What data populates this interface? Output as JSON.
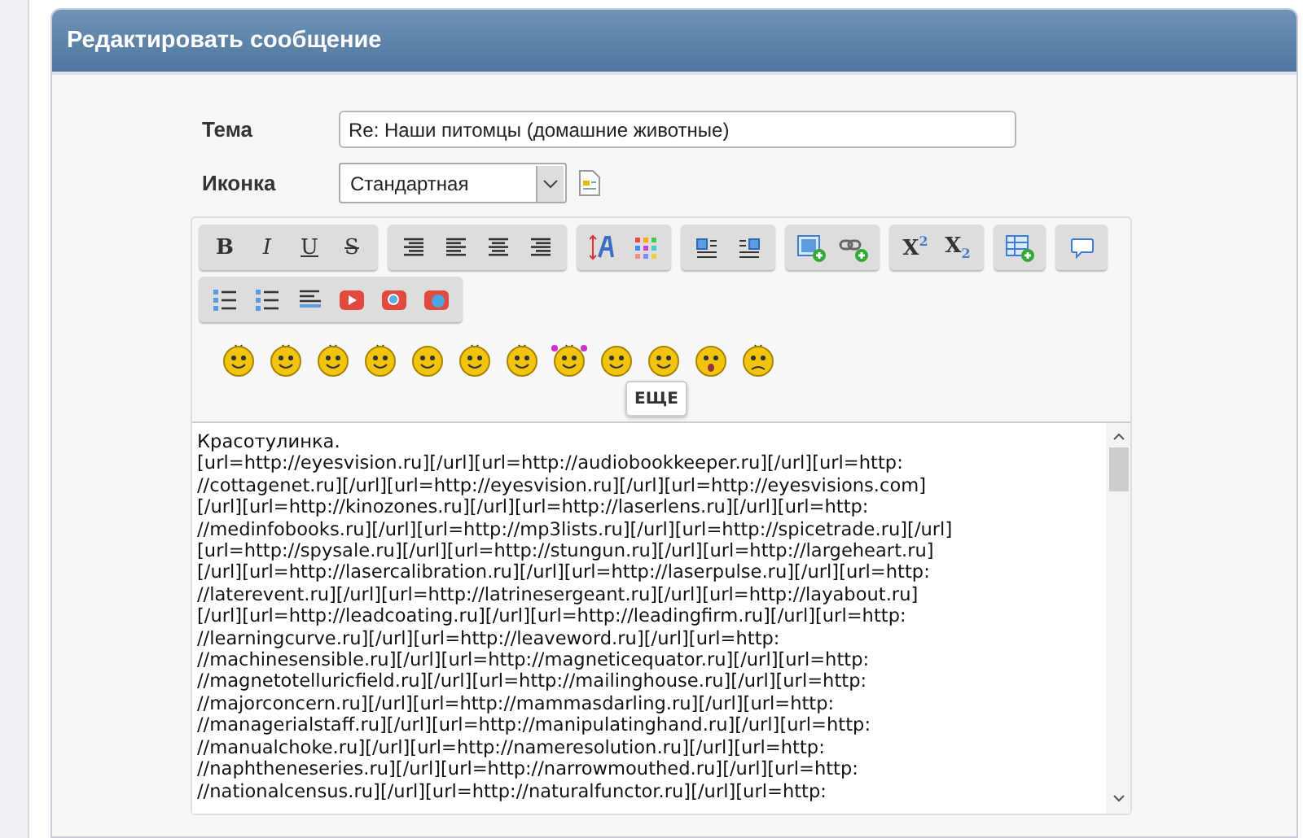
{
  "panel": {
    "title": "Редактировать сообщение"
  },
  "subject": {
    "label": "Тема",
    "value": "Re: Наши питомцы (домашние животные)"
  },
  "icon_field": {
    "label": "Иконка",
    "value": "Стандартная"
  },
  "toolbar": [
    {
      "buttons": [
        {
          "kind": "bold",
          "label": "B"
        },
        {
          "kind": "italic",
          "label": "I"
        },
        {
          "kind": "underline",
          "label": "U"
        },
        {
          "kind": "strike",
          "label": "S"
        }
      ]
    },
    {
      "buttons": [
        {
          "kind": "justify"
        },
        {
          "kind": "align-left"
        },
        {
          "kind": "align-center"
        },
        {
          "kind": "align-right"
        }
      ]
    },
    {
      "buttons": [
        {
          "kind": "font-size"
        },
        {
          "kind": "color"
        }
      ]
    },
    {
      "buttons": [
        {
          "kind": "float-right"
        },
        {
          "kind": "float-left"
        }
      ]
    },
    {
      "buttons": [
        {
          "kind": "image"
        },
        {
          "kind": "link"
        }
      ]
    },
    {
      "buttons": [
        {
          "kind": "sup",
          "label": "X",
          "sub": "2"
        },
        {
          "kind": "sub",
          "label": "X",
          "sub": "2"
        }
      ]
    },
    {
      "buttons": [
        {
          "kind": "table"
        }
      ]
    },
    {
      "buttons": [
        {
          "kind": "quote"
        }
      ]
    },
    {
      "buttons": [
        {
          "kind": "bullets"
        },
        {
          "kind": "numbers"
        },
        {
          "kind": "rule"
        },
        {
          "kind": "video"
        },
        {
          "kind": "media"
        },
        {
          "kind": "embed"
        }
      ]
    }
  ],
  "smileys": [
    {
      "kind": "smile"
    },
    {
      "kind": "wink"
    },
    {
      "kind": "kiss"
    },
    {
      "kind": "angel"
    },
    {
      "kind": "smirk"
    },
    {
      "kind": "wave"
    },
    {
      "kind": "mask"
    },
    {
      "kind": "girl"
    },
    {
      "kind": "grin"
    },
    {
      "kind": "happy"
    },
    {
      "kind": "shock"
    },
    {
      "kind": "sad"
    }
  ],
  "more_button": "ЕЩЕ",
  "body_lines": [
    "Красотулинка.",
    "[url=http://eyesvision.ru][/url][url=http://audiobookkeeper.ru][/url][url=http:",
    "//cottagenet.ru][/url][url=http://eyesvision.ru][/url][url=http://eyesvisions.com]",
    "[/url][url=http://kinozones.ru][/url][url=http://laserlens.ru][/url][url=http:",
    "//medinfobooks.ru][/url][url=http://mp3lists.ru][/url][url=http://spicetrade.ru][/url]",
    "[url=http://spysale.ru][/url][url=http://stungun.ru][/url][url=http://largeheart.ru]",
    "[/url][url=http://lasercalibration.ru][/url][url=http://laserpulse.ru][/url][url=http:",
    "//laterevent.ru][/url][url=http://latrinesergeant.ru][/url][url=http://layabout.ru]",
    "[/url][url=http://leadcoating.ru][/url][url=http://leadingfirm.ru][/url][url=http:",
    "//learningcurve.ru][/url][url=http://leaveword.ru][/url][url=http:",
    "//machinesensible.ru][/url][url=http://magneticequator.ru][/url][url=http:",
    "//magnetotelluricfield.ru][/url][url=http://mailinghouse.ru][/url][url=http:",
    "//majorconcern.ru][/url][url=http://mammasdarling.ru][/url][url=http:",
    "//managerialstaff.ru][/url][url=http://manipulatinghand.ru][/url][url=http:",
    "//manualchoke.ru][/url][url=http://nameresolution.ru][/url][url=http:",
    "//naphtheneseries.ru][/url][url=http://narrowmouthed.ru][/url][url=http:",
    "//nationalcensus.ru][/url][url=http://naturalfunctor.ru][/url][url=http:"
  ]
}
